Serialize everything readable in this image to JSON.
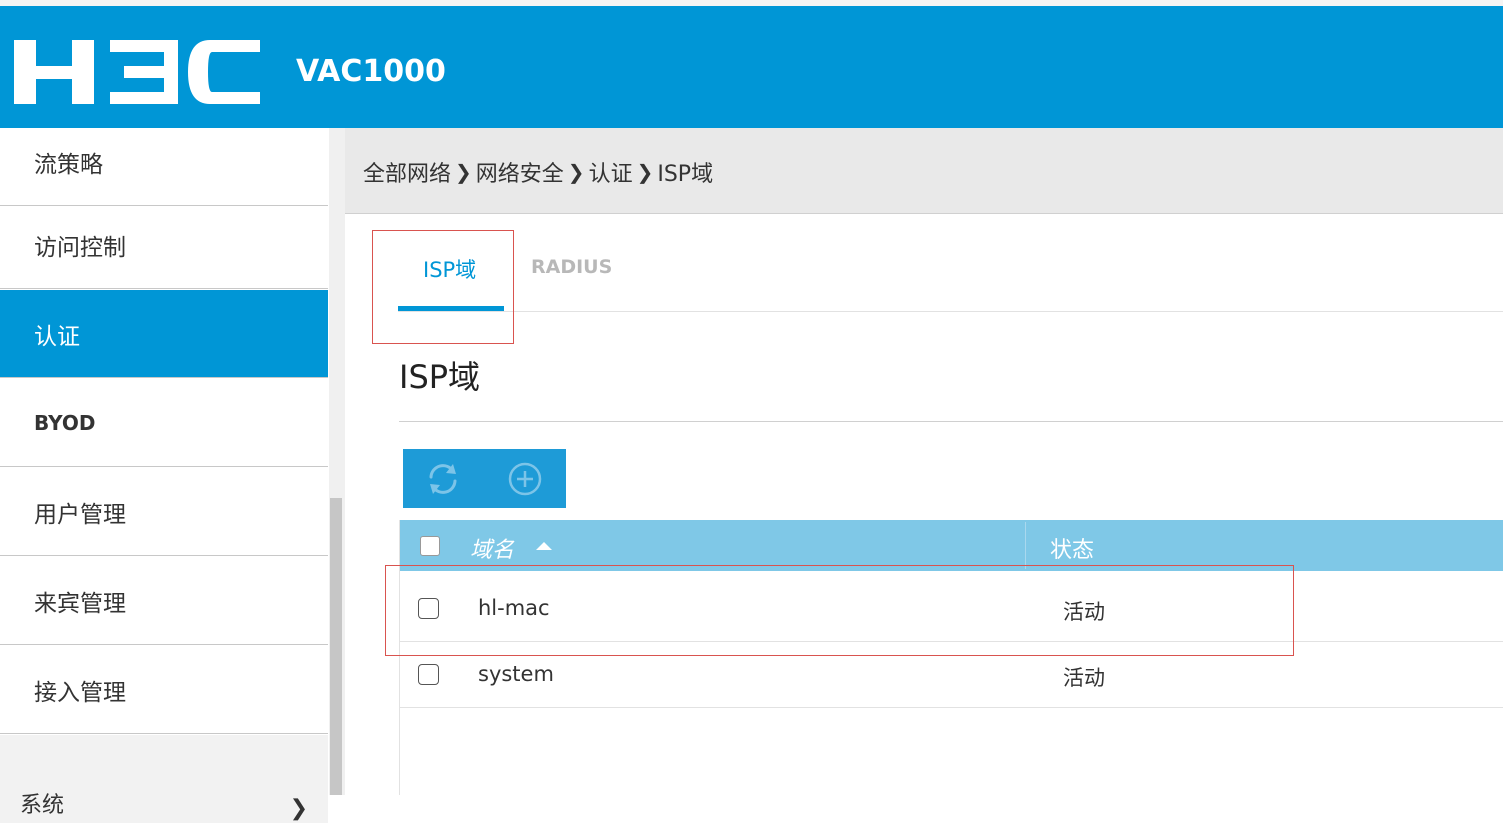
{
  "header": {
    "logo_text": "H3C",
    "product_name": "VAC1000",
    "brand_color": "#0096d6"
  },
  "sidebar": {
    "items": [
      {
        "label": "流策略"
      },
      {
        "label": "访问控制"
      },
      {
        "label": "认证",
        "active": true
      },
      {
        "label": "BYOD"
      },
      {
        "label": "用户管理"
      },
      {
        "label": "来宾管理"
      },
      {
        "label": "接入管理"
      },
      {
        "label": "系统",
        "icon": "chevron-right-icon"
      }
    ]
  },
  "breadcrumb": {
    "items": [
      "全部网络",
      "网络安全",
      "认证",
      "ISP域"
    ],
    "separator_icon": "chevron-right-icon"
  },
  "tabs": [
    {
      "label": "ISP域",
      "active": true
    },
    {
      "label": "RADIUS",
      "active": false
    }
  ],
  "page": {
    "title": "ISP域"
  },
  "toolbar": {
    "buttons": [
      {
        "icon": "refresh-icon"
      },
      {
        "icon": "add-circle-icon"
      }
    ]
  },
  "table": {
    "columns": [
      "域名",
      "状态"
    ],
    "sort_icon": "sort-ascending-icon",
    "rows": [
      {
        "name": "hl-mac",
        "status": "活动",
        "checked": false
      },
      {
        "name": "system",
        "status": "活动",
        "checked": false
      }
    ]
  }
}
